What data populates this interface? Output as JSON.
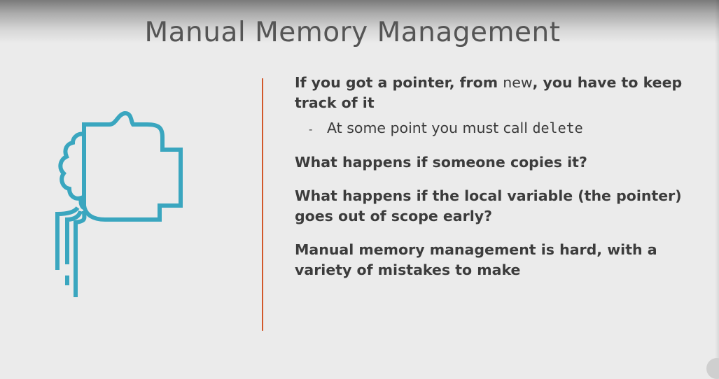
{
  "slide": {
    "title": "Manual Memory Management",
    "bullets": [
      {
        "part1": "If you got a pointer, from ",
        "code": "new",
        "part2": ", you have to keep track of it",
        "sub": {
          "dash": "-",
          "text": "At some point you must call ",
          "code": "delete"
        }
      },
      {
        "text": "What happens if someone copies it?"
      },
      {
        "text": "What happens if the local variable  (the pointer) goes out of scope early?"
      },
      {
        "text": "Manual memory management is hard, with a variety of mistakes to make"
      }
    ]
  },
  "colors": {
    "accent": "#d2582a",
    "icon": "#3aa6bf",
    "text": "#3c3c3c",
    "title": "#555555",
    "background": "#ebebeb"
  },
  "icons": {
    "illustration": "head-profile-with-brain-icon"
  }
}
